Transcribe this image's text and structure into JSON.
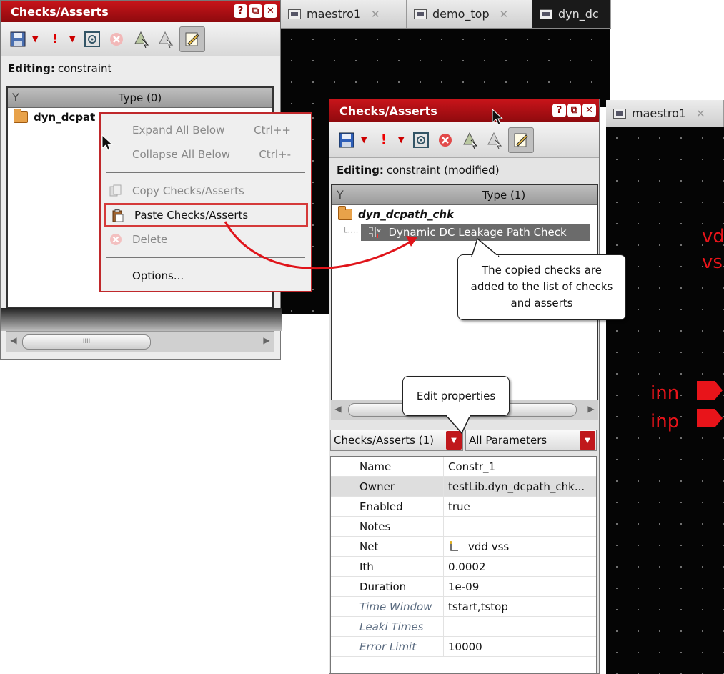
{
  "left_panel": {
    "title": "Checks/Asserts",
    "window_buttons": [
      "?",
      "⧉",
      "✕"
    ],
    "editing_label": "Editing:",
    "editing_value": "constraint",
    "tree_header": "Type (0)",
    "tree_item": "dyn_dcpat",
    "scroll_thumb_mark": "IIII"
  },
  "context_menu": {
    "items": [
      {
        "label": "Expand All Below",
        "shortcut": "Ctrl++",
        "enabled": false
      },
      {
        "label": "Collapse All Below",
        "shortcut": "Ctrl+-",
        "enabled": false
      },
      {
        "label": "Copy Checks/Asserts",
        "shortcut": "",
        "enabled": false
      },
      {
        "label": "Paste Checks/Asserts",
        "shortcut": "",
        "enabled": true
      },
      {
        "label": "Delete",
        "shortcut": "",
        "enabled": false
      },
      {
        "label": "Options...",
        "shortcut": "",
        "enabled": true
      }
    ]
  },
  "top_tabs": [
    {
      "label": "maestro1",
      "close": "✕"
    },
    {
      "label": "demo_top",
      "close": "✕"
    },
    {
      "label": "dyn_dc",
      "close": ""
    }
  ],
  "right_tabs": [
    {
      "label": "maestro1",
      "close": "✕"
    }
  ],
  "right_panel": {
    "title": "Checks/Asserts",
    "window_buttons": [
      "?",
      "⧉",
      "✕"
    ],
    "editing_label": "Editing:",
    "editing_value": "constraint (modified)",
    "tree_header": "Type (1)",
    "tree_parent": "dyn_dcpath_chk",
    "tree_child": "Dynamic DC Leakage Path Check",
    "selector_left": "Checks/Asserts (1)",
    "selector_right": "All Parameters",
    "properties": [
      {
        "name": "Name",
        "value": "Constr_1",
        "italic": false
      },
      {
        "name": "Owner",
        "value": "testLib.dyn_dcpath_chk...",
        "italic": false
      },
      {
        "name": "Enabled",
        "value": "true",
        "italic": false
      },
      {
        "name": "Notes",
        "value": "",
        "italic": false
      },
      {
        "name": "Net",
        "value": "vdd vss",
        "italic": false
      },
      {
        "name": "Ith",
        "value": "0.0002",
        "italic": false
      },
      {
        "name": "Duration",
        "value": "1e-09",
        "italic": false
      },
      {
        "name": "Time Window",
        "value": "tstart,tstop",
        "italic": true
      },
      {
        "name": "Leaki Times",
        "value": "",
        "italic": true
      },
      {
        "name": "Error Limit",
        "value": "10000",
        "italic": true
      }
    ]
  },
  "callouts": {
    "copied": "The copied checks are added to the list of checks and asserts",
    "edit": "Edit properties"
  },
  "schematic_labels": {
    "top1": "vd",
    "top2": "vs",
    "pin1": "inn",
    "pin2": "inp"
  },
  "colors": {
    "title_red": "#b5101a",
    "accent_red": "#e8141a",
    "canvas": "#050505"
  }
}
